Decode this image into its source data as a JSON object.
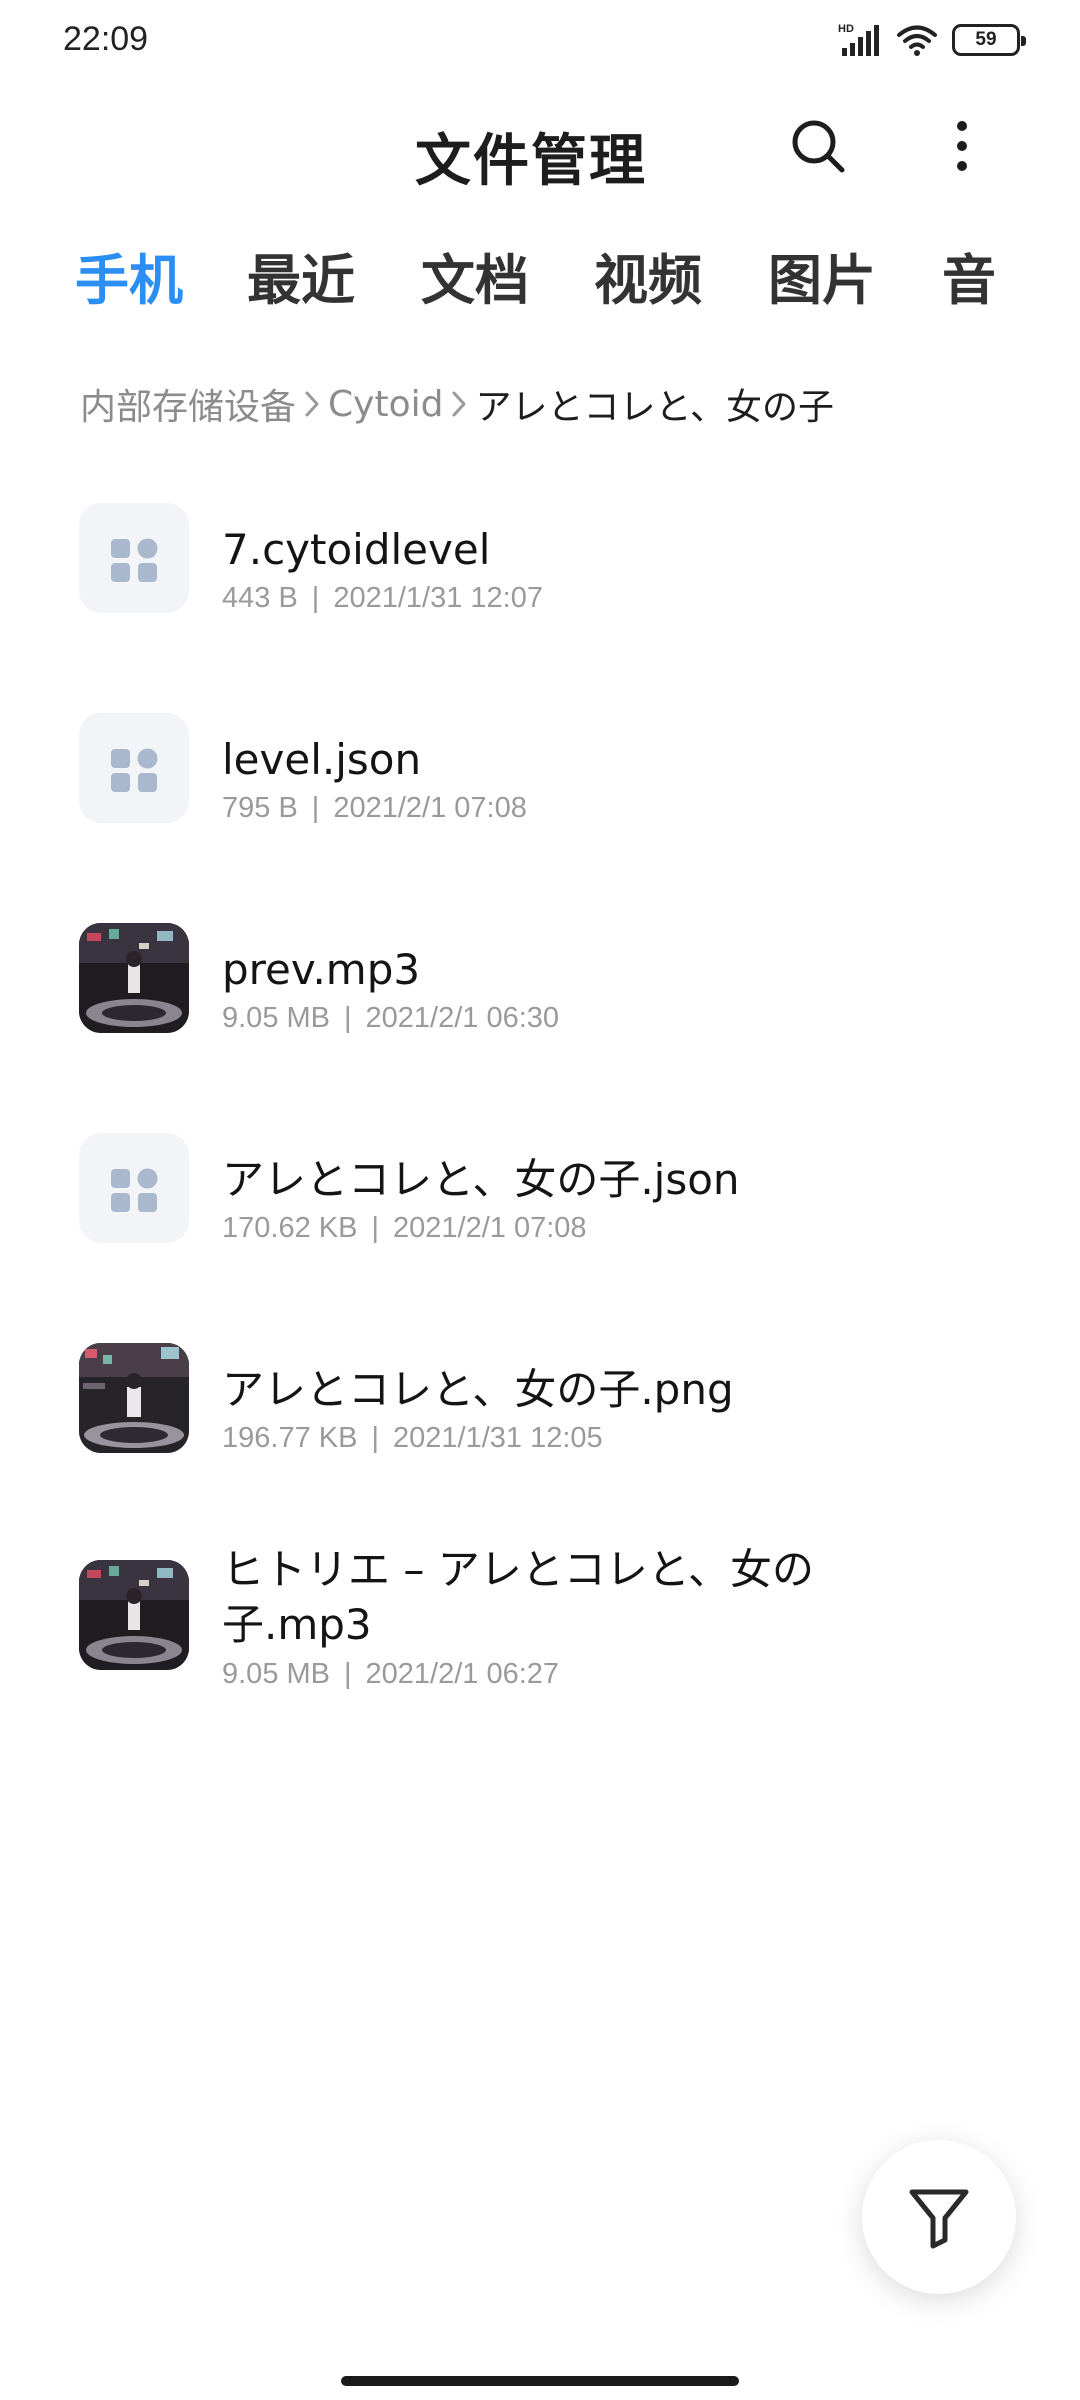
{
  "status_bar": {
    "time": "22:09",
    "network_label": "HD",
    "battery_level": "59",
    "icons": [
      "signal-icon",
      "wifi-icon",
      "battery-icon"
    ]
  },
  "header": {
    "title": "文件管理",
    "search_icon": "search-icon",
    "more_icon": "more-vertical-icon"
  },
  "tabs": [
    {
      "label": "手机",
      "active": true
    },
    {
      "label": "最近",
      "active": false
    },
    {
      "label": "文档",
      "active": false
    },
    {
      "label": "视频",
      "active": false
    },
    {
      "label": "图片",
      "active": false
    },
    {
      "label": "音",
      "active": false
    }
  ],
  "breadcrumb": [
    "内部存储设备",
    "Cytoid",
    "アレとコレと、女の子"
  ],
  "files": [
    {
      "name": "7.cytoidlevel",
      "size": "443 B",
      "date": "2021/1/31 12:07",
      "thumb": "generic"
    },
    {
      "name": "level.json",
      "size": "795 B",
      "date": "2021/2/1 07:08",
      "thumb": "generic"
    },
    {
      "name": "prev.mp3",
      "size": "9.05 MB",
      "date": "2021/2/1 06:30",
      "thumb": "image"
    },
    {
      "name": "アレとコレと、女の子.json",
      "size": "170.62 KB",
      "date": "2021/2/1 07:08",
      "thumb": "generic"
    },
    {
      "name": "アレとコレと、女の子.png",
      "size": "196.77 KB",
      "date": "2021/1/31 12:05",
      "thumb": "image"
    },
    {
      "name": "ヒトリエ – アレとコレと、女の子.mp3",
      "name_line1": "ヒトリエ – アレとコレと、女の",
      "name_line2": "子.mp3",
      "size": "9.05 MB",
      "date": "2021/2/1 06:27",
      "thumb": "image"
    }
  ],
  "meta_separator": "|",
  "fab": {
    "icon": "filter-icon"
  },
  "colors": {
    "accent": "#2b8ef2",
    "text_primary": "#141414",
    "text_secondary": "#9a9a9a",
    "thumb_background": "#f2f4f7",
    "thumb_glyph": "#a9b8cc"
  }
}
